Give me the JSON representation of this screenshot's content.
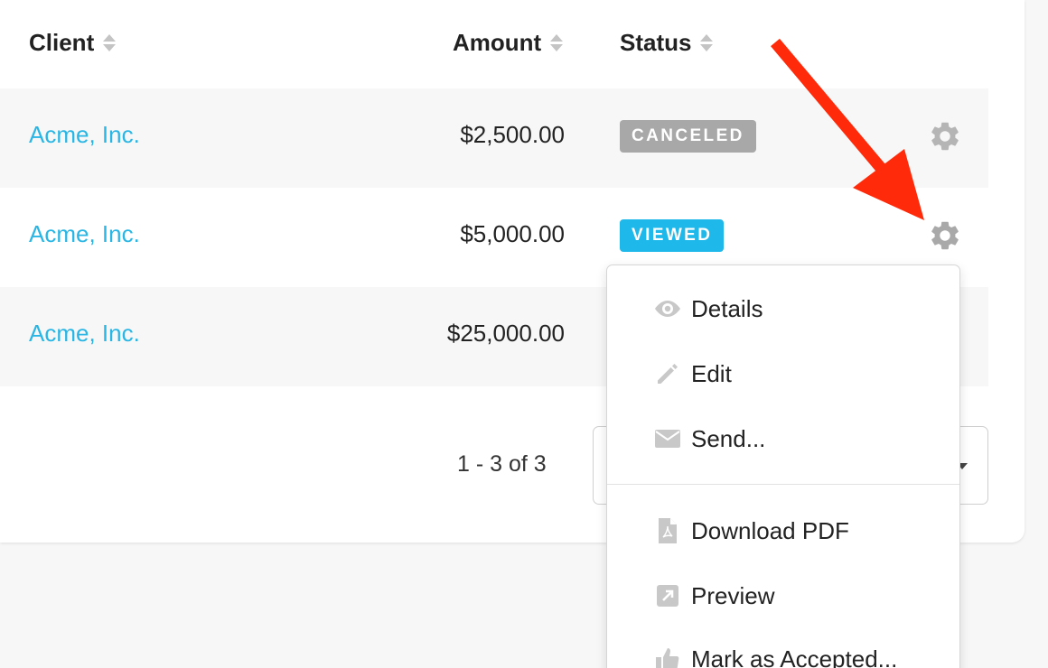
{
  "table": {
    "headers": {
      "client": "Client",
      "amount": "Amount",
      "status": "Status"
    },
    "rows": [
      {
        "client": "Acme, Inc.",
        "amount": "$2,500.00",
        "status": "CANCELED",
        "status_color": "#a8a8a8"
      },
      {
        "client": "Acme, Inc.",
        "amount": "$5,000.00",
        "status": "VIEWED",
        "status_color": "#1fb8ea"
      },
      {
        "client": "Acme, Inc.",
        "amount": "$25,000.00",
        "status": "",
        "status_color": ""
      }
    ]
  },
  "pagination": {
    "range_text": "1 - 3 of 3"
  },
  "actions_menu": {
    "items": [
      {
        "label": "Details",
        "icon": "eye-icon"
      },
      {
        "label": "Edit",
        "icon": "pencil-icon"
      },
      {
        "label": "Send...",
        "icon": "envelope-icon"
      },
      {
        "label": "Download PDF",
        "icon": "pdf-file-icon"
      },
      {
        "label": "Preview",
        "icon": "external-link-icon"
      },
      {
        "label": "Mark as Accepted...",
        "icon": "thumbs-up-icon"
      }
    ]
  },
  "colors": {
    "link": "#29b6e5",
    "annotation_arrow": "#ff2a0a",
    "gear": "#b5b5b5",
    "menu_icon": "#c8c8c8"
  }
}
